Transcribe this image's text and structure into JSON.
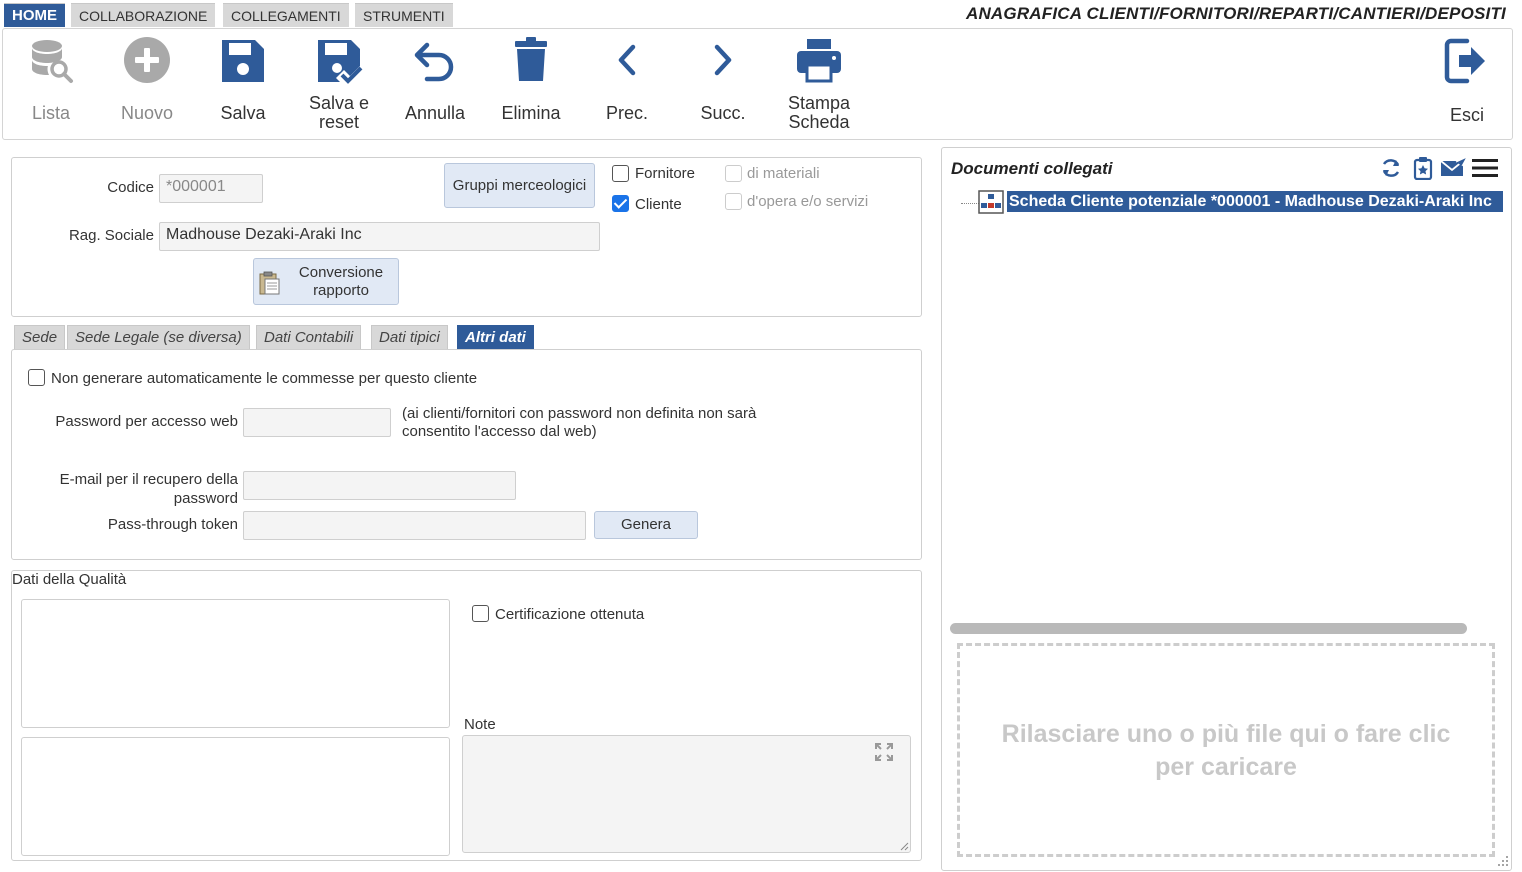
{
  "menu": {
    "tabs": [
      {
        "label": "HOME"
      },
      {
        "label": "COLLABORAZIONE"
      },
      {
        "label": "COLLEGAMENTI"
      },
      {
        "label": "STRUMENTI"
      }
    ],
    "page_title": "ANAGRAFICA CLIENTI/FORNITORI/REPARTI/CANTIERI/DEPOSITI"
  },
  "toolbar": {
    "lista": "Lista",
    "nuovo": "Nuovo",
    "salva": "Salva",
    "salva_reset_1": "Salva e",
    "salva_reset_2": "reset",
    "annulla": "Annulla",
    "elimina": "Elimina",
    "prec": "Prec.",
    "succ": "Succ.",
    "stampa_1": "Stampa",
    "stampa_2": "Scheda",
    "esci": "Esci"
  },
  "header_form": {
    "codice_label": "Codice",
    "codice_value": "*000001",
    "rag_sociale_label": "Rag. Sociale",
    "rag_sociale_value": "Madhouse Dezaki-Araki Inc",
    "gruppi_button": "Gruppi merceologici",
    "conversione_1": "Conversione",
    "conversione_2": "rapporto",
    "fornitore_label": "Fornitore",
    "cliente_label": "Cliente",
    "di_materiali_label": "di materiali",
    "opera_label": "d'opera e/o servizi"
  },
  "tabs": [
    {
      "label": "Sede"
    },
    {
      "label": "Sede Legale (se diversa)"
    },
    {
      "label": "Dati Contabili"
    },
    {
      "label": "Dati tipici"
    },
    {
      "label": "Altri dati"
    }
  ],
  "altri_dati": {
    "no_commesse_label": "Non generare automaticamente le commesse per questo cliente",
    "password_label": "Password per accesso web",
    "password_note_1": "(ai clienti/fornitori con password non definita non sarà",
    "password_note_2": "consentito l'accesso dal web)",
    "email_label_1": "E-mail per il recupero della",
    "email_label_2": "password",
    "token_label": "Pass-through token",
    "genera_button": "Genera"
  },
  "qualita": {
    "title": "Dati della Qualità",
    "certificazione_label": "Certificazione ottenuta",
    "note_label": "Note"
  },
  "documenti": {
    "title": "Documenti collegati",
    "item": "Scheda Cliente potenziale *000001 - Madhouse Dezaki-Araki Inc",
    "dropzone_1": "Rilasciare uno o più file qui o fare clic",
    "dropzone_2": "per caricare"
  },
  "colors": {
    "accent": "#2f5b99",
    "checkbox": "#1a73e8"
  }
}
